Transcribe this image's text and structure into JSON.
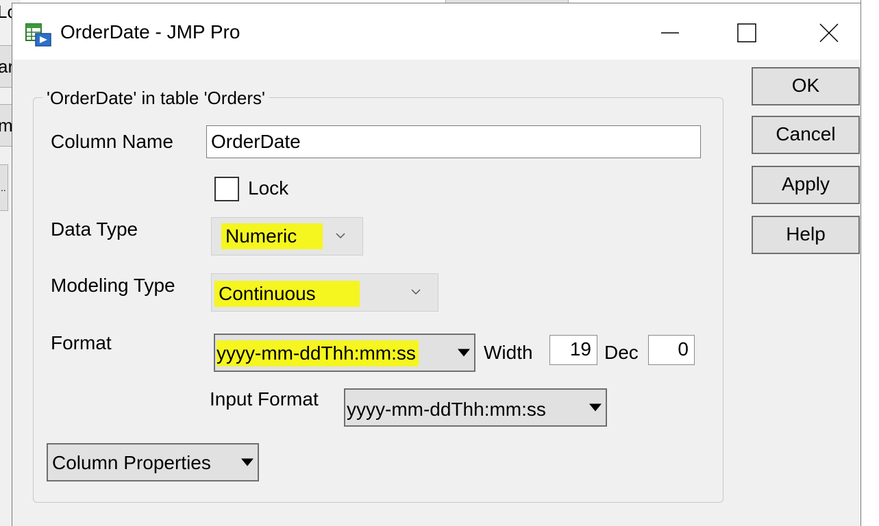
{
  "background": {
    "fragments": [
      "Lo",
      "ar",
      "m",
      "..."
    ],
    "apply_label": "Apply"
  },
  "window": {
    "title": "OrderDate - JMP Pro",
    "minimize_icon": "minimize-icon",
    "maximize_icon": "maximize-icon",
    "close_icon": "close-icon"
  },
  "group": {
    "title": "'OrderDate' in table 'Orders'"
  },
  "form": {
    "column_name_label": "Column Name",
    "column_name_value": "OrderDate",
    "lock_label": "Lock",
    "lock_checked": false,
    "data_type_label": "Data Type",
    "data_type_value": "Numeric",
    "modeling_type_label": "Modeling Type",
    "modeling_type_value": "Continuous",
    "format_label": "Format",
    "format_value": "yyyy-mm-ddThh:mm:ss",
    "width_label": "Width",
    "width_value": "19",
    "dec_label": "Dec",
    "dec_value": "0",
    "input_format_label": "Input Format",
    "input_format_value": "yyyy-mm-ddThh:mm:ss",
    "column_properties_label": "Column Properties"
  },
  "buttons": {
    "ok": "OK",
    "cancel": "Cancel",
    "apply": "Apply",
    "help": "Help"
  },
  "colors": {
    "highlight": "#f5f520",
    "dialog_bg": "#f0f0f0",
    "button_bg": "#e1e1e1"
  }
}
